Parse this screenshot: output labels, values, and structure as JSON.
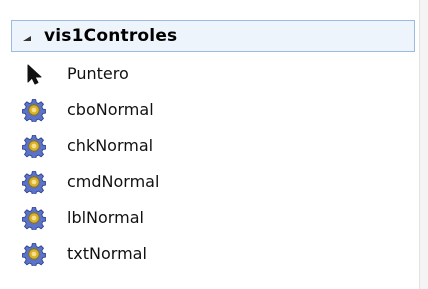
{
  "toolbox": {
    "group": {
      "title": "vis1Controles",
      "expanded": true,
      "expander_icon": "collapse-triangle-icon",
      "items": [
        {
          "label": "Puntero",
          "icon": "pointer-arrow-icon"
        },
        {
          "label": "cboNormal",
          "icon": "gear-component-icon"
        },
        {
          "label": "chkNormal",
          "icon": "gear-component-icon"
        },
        {
          "label": "cmdNormal",
          "icon": "gear-component-icon"
        },
        {
          "label": "lblNormal",
          "icon": "gear-component-icon"
        },
        {
          "label": "txtNormal",
          "icon": "gear-component-icon"
        }
      ]
    }
  },
  "colors": {
    "header_background": "#eef4fb",
    "header_border": "#9bbbe0",
    "gear_blue": "#5a72c8",
    "gear_dark": "#2c3f8a",
    "gear_gold": "#d8b12a"
  }
}
